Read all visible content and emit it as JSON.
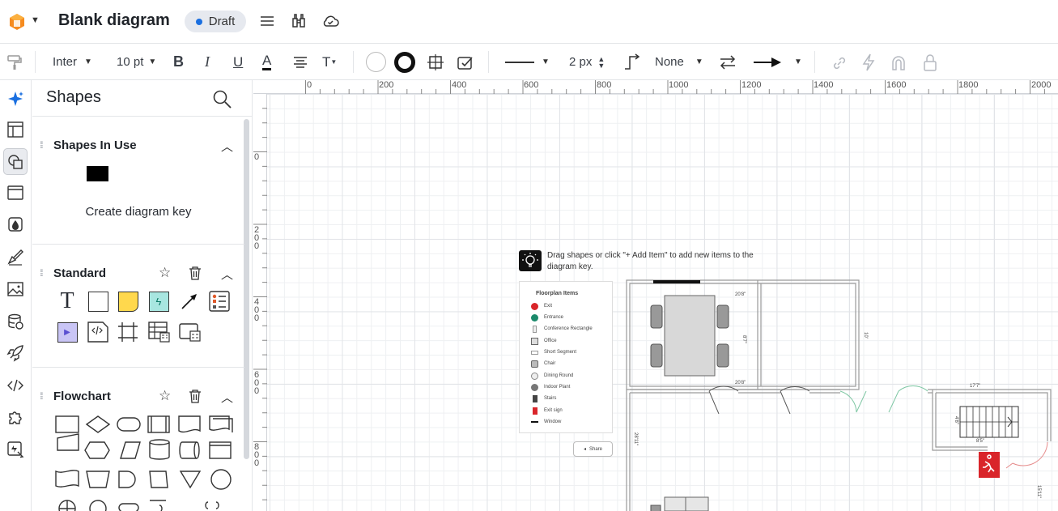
{
  "app": {
    "title": "Blank diagram",
    "status_badge": "Draft"
  },
  "toolbar": {
    "font_family": "Inter",
    "font_size": "10 pt",
    "line_width": "2 px",
    "arrow_start": "None"
  },
  "panel": {
    "title": "Shapes",
    "sections": {
      "in_use": {
        "title": "Shapes In Use",
        "create_key_label": "Create diagram key"
      },
      "standard": {
        "title": "Standard"
      },
      "flowchart": {
        "title": "Flowchart"
      }
    }
  },
  "ruler": {
    "top_labels": [
      "0",
      "200",
      "400",
      "600",
      "800",
      "1000",
      "1200",
      "1400",
      "1600",
      "1800",
      "2000"
    ],
    "left_labels": [
      "0",
      "200",
      "400",
      "600",
      "800"
    ]
  },
  "canvas": {
    "tip_text": "Drag shapes or click \"+ Add Item\" to add new items to the diagram key.",
    "key_title": "Floorplan Items",
    "key_items": [
      {
        "label": "Exit",
        "color": "#d9252a"
      },
      {
        "label": "Entrance",
        "color": "#1b8a6b"
      },
      {
        "label": "Conference Rectangle",
        "color": "#cccccc"
      },
      {
        "label": "Office",
        "color": "#999999"
      },
      {
        "label": "Short Segment",
        "color": "#dddddd"
      },
      {
        "label": "Chair",
        "color": "#888888"
      },
      {
        "label": "Dining Round",
        "color": "#cccccc"
      },
      {
        "label": "Indoor Plant",
        "color": "#777777"
      },
      {
        "label": "Stairs",
        "color": "#555555"
      },
      {
        "label": "Exit sign",
        "color": "#d9252a"
      },
      {
        "label": "Window",
        "color": "#222222"
      }
    ],
    "share_label": "Share",
    "dimensions": [
      "20'8\"",
      "8'7\"",
      "20'8\"",
      "10'",
      "17'7\"",
      "4'8\"",
      "8'5\"",
      "28'11\"",
      "15'11\""
    ]
  },
  "colors": {
    "accent": "#1a6fe0",
    "exit_red": "#d9252a",
    "door_green": "#7fc7a4"
  }
}
